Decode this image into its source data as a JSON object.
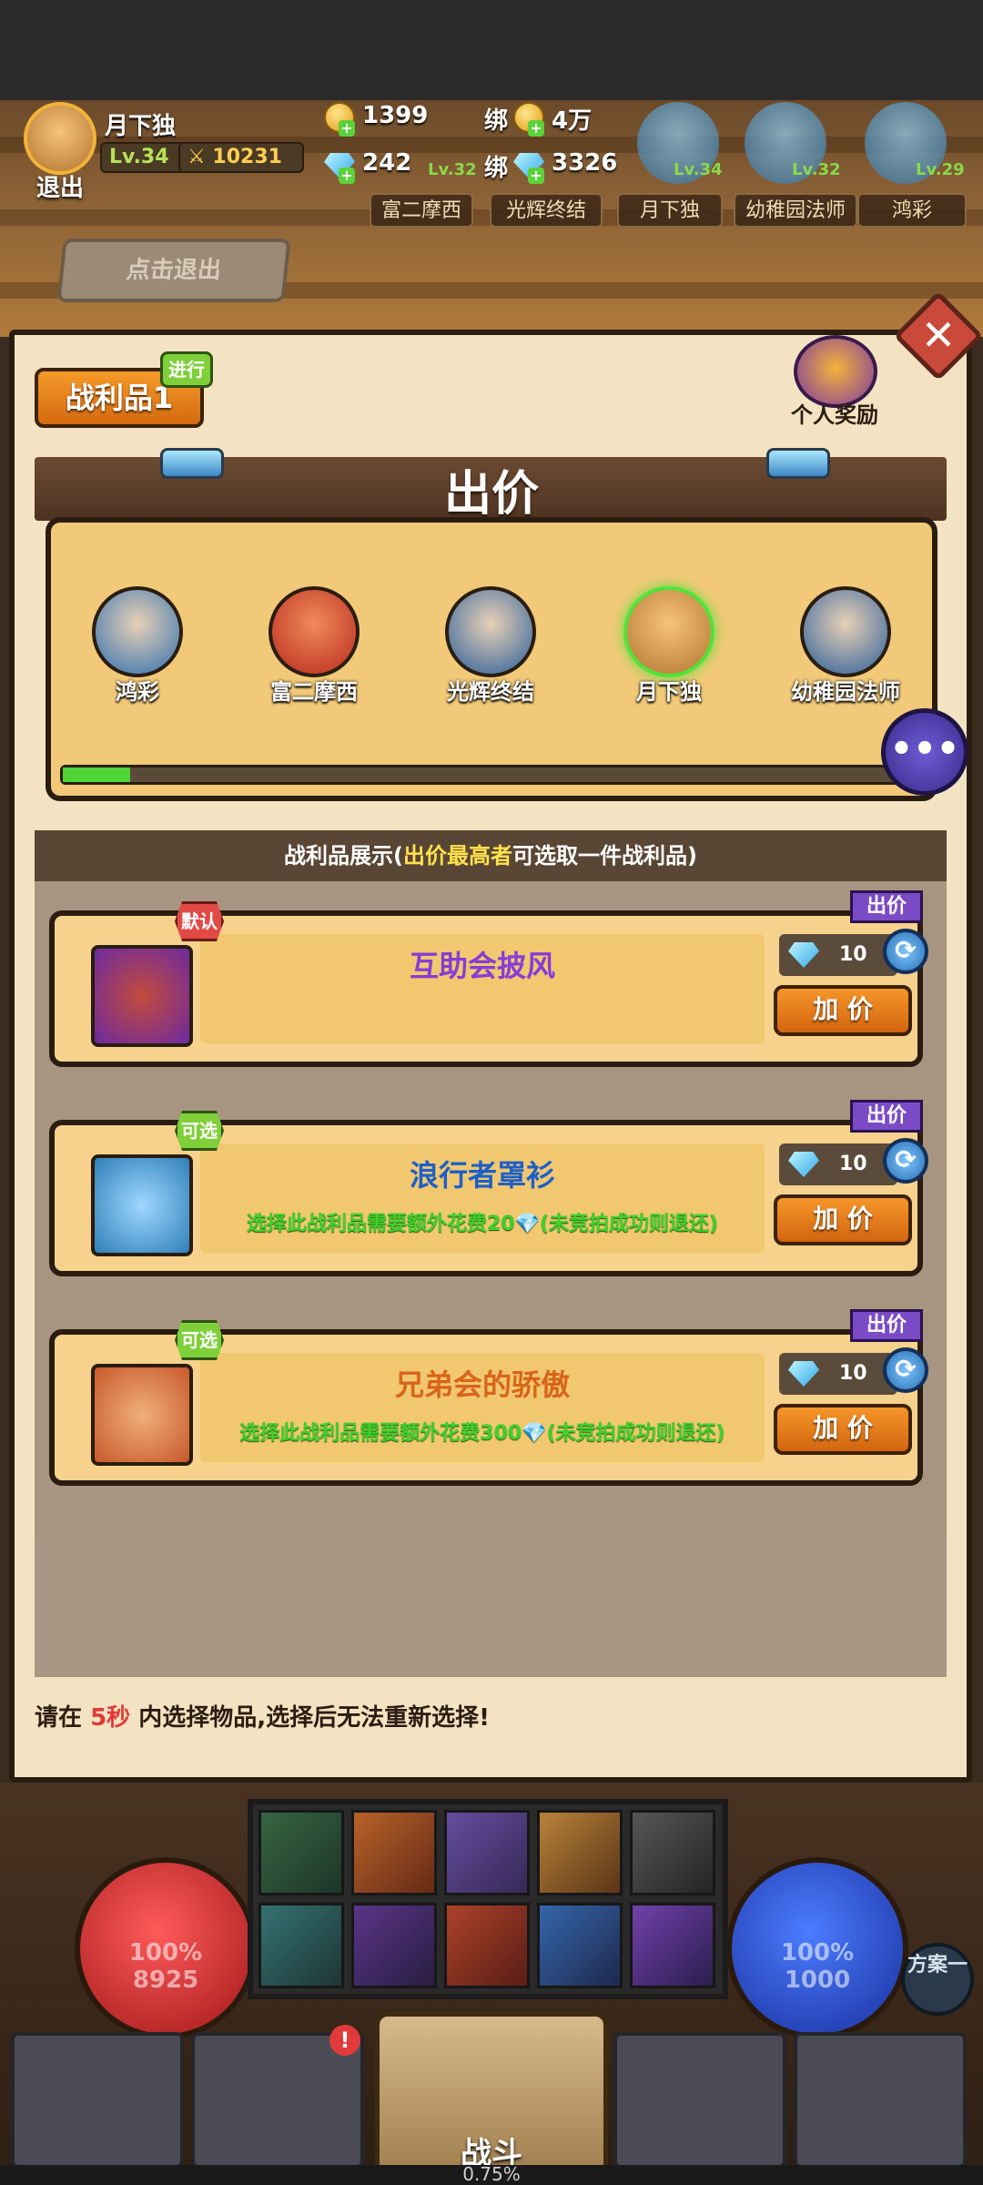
{
  "player": {
    "name": "月下独",
    "level": "Lv.34",
    "power": "10231",
    "exit_label": "退出"
  },
  "currencies": {
    "gold": "1399",
    "bound_gold_label": "绑",
    "bound_gold": "4万",
    "diamond": "242",
    "bound_diamond_label": "绑",
    "bound_diamond": "3326"
  },
  "team": [
    {
      "name": "富二摩西",
      "level": "Lv.32"
    },
    {
      "name": "光辉终结",
      "level": "Lv.32"
    },
    {
      "name": "月下独",
      "level": "Lv.34"
    },
    {
      "name": "幼稚园法师",
      "level": "Lv.32"
    },
    {
      "name": "鸿彩",
      "level": "Lv.29"
    }
  ],
  "exit_button": "点击退出",
  "panel": {
    "tab_label": "战利品1",
    "status_badge": "进行",
    "personal_reward": "个人奖励",
    "bid_title": "出价",
    "bidders": [
      "鸿彩",
      "富二摩西",
      "光辉终结",
      "月下独",
      "幼稚园法师"
    ],
    "highlighted_bidder": "月下独",
    "progress": 0.08,
    "chat_icon": "speech-bubble-icon",
    "caption_prefix": "战利品展示(",
    "caption_highlight": "出价最高者",
    "caption_suffix": "可选取一件战利品)"
  },
  "loot_items": [
    {
      "badge": "默认",
      "badge_color": "#e04a45",
      "name": "互助会披风",
      "name_color": "#8a3bd6",
      "note": "",
      "bid_tag": "出价",
      "price": "10",
      "button": "加 价",
      "icon": "red-cloak-icon"
    },
    {
      "badge": "可选",
      "badge_color": "#7fcf3a",
      "name": "浪行者罩衫",
      "name_color": "#1d5fc8",
      "note": "选择此战利品需要额外花费20💎(未竞拍成功则退还)",
      "bid_tag": "出价",
      "price": "10",
      "button": "加 价",
      "icon": "green-tunic-icon"
    },
    {
      "badge": "可选",
      "badge_color": "#7fcf3a",
      "name": "兄弟会的骄傲",
      "name_color": "#d9641a",
      "note": "选择此战利品需要额外花费300💎(未竞拍成功则退还)",
      "bid_tag": "出价",
      "price": "10",
      "button": "加 价",
      "icon": "ruby-ring-icon"
    }
  ],
  "timer": {
    "prefix": "请在",
    "seconds": "5秒",
    "suffix": "内选择物品,选择后无法重新选择!"
  },
  "hud": {
    "hp_percent": "100%",
    "hp_value": "8925",
    "mp_percent": "100%",
    "mp_value": "1000",
    "scheme_label": "方案一",
    "battle_label": "战斗",
    "exp_text": "0.75%"
  },
  "colors": {
    "accent_orange": "#e07a1a",
    "progress_green": "#4fd43a",
    "panel_bg": "#f4e3c2"
  }
}
